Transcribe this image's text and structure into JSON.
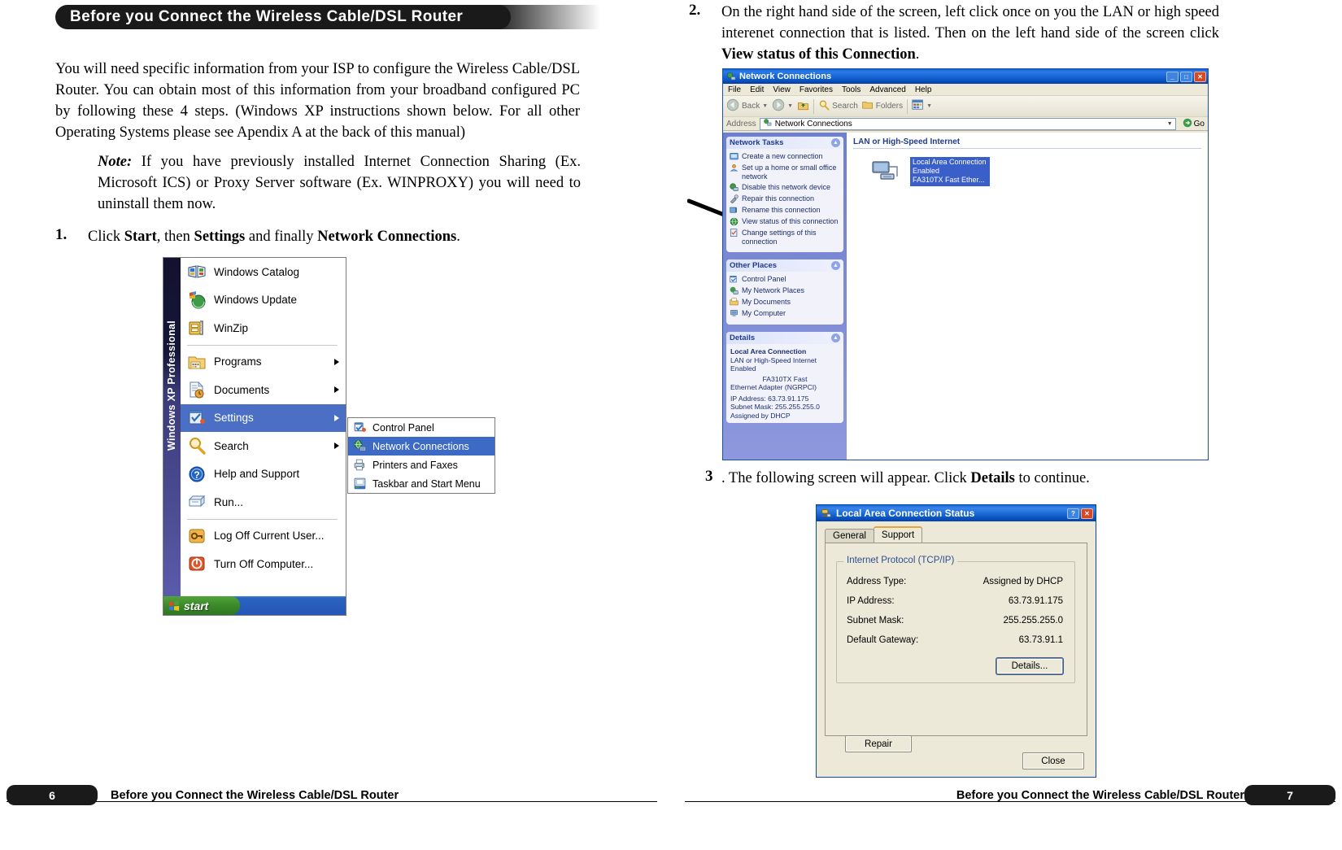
{
  "banner": {
    "title": "Before you Connect the Wireless Cable/DSL Router"
  },
  "intro": {
    "paragraph": "You will need specific information from your ISP to configure the Wireless Cable/DSL Router. You can obtain most of this information from your broadband configured PC by following these 4 steps. (Windows XP instructions shown below. For all other Operating Systems please see Apendix A at the back of this manual)",
    "note_label": "Note:",
    "note_text": "If you have previously installed Internet Connection Sharing (Ex. Microsoft ICS) or Proxy Server software (Ex. WINPROXY) you will need to uninstall them now."
  },
  "steps": {
    "one_num": "1.",
    "one_a": "Click ",
    "one_b1": "Start",
    "one_c": ", then ",
    "one_b2": "Settings",
    "one_d": " and finally ",
    "one_b3": "Network Connections",
    "one_e": ".",
    "two_num": "2.",
    "two_a": "On the right hand side of the screen, left click once on you the LAN or high speed interenet connection that is listed. Then on the left hand side of the screen click ",
    "two_b": "View status of this Connection",
    "two_c": ".",
    "three_num": "3",
    "three_a": ". The following screen will appear. Click ",
    "three_b": "Details",
    "three_c": " to continue."
  },
  "startmenu": {
    "sidebar_text": "Windows XP Professional",
    "items": [
      {
        "label": "Windows Catalog",
        "icon": "windows-catalog-icon",
        "arrow": false
      },
      {
        "label": "Windows Update",
        "icon": "windows-update-icon",
        "arrow": false
      },
      {
        "label": "WinZip",
        "icon": "winzip-icon",
        "arrow": false
      },
      {
        "label": "Programs",
        "icon": "programs-folder-icon",
        "arrow": true
      },
      {
        "label": "Documents",
        "icon": "documents-icon",
        "arrow": true
      },
      {
        "label": "Settings",
        "icon": "settings-icon",
        "arrow": true,
        "selected": true
      },
      {
        "label": "Search",
        "icon": "search-magnifier-icon",
        "arrow": true
      },
      {
        "label": "Help and Support",
        "icon": "help-question-icon",
        "arrow": false
      },
      {
        "label": "Run...",
        "icon": "run-icon",
        "arrow": false
      },
      {
        "label": "Log Off Current User...",
        "icon": "log-off-key-icon",
        "arrow": false
      },
      {
        "label": "Turn Off Computer...",
        "icon": "power-icon",
        "arrow": false
      }
    ],
    "submenu": [
      {
        "label": "Control Panel",
        "icon": "control-panel-icon",
        "selected": false
      },
      {
        "label": "Network Connections",
        "icon": "network-connections-icon",
        "selected": true
      },
      {
        "label": "Printers and Faxes",
        "icon": "printers-faxes-icon",
        "selected": false
      },
      {
        "label": "Taskbar and Start Menu",
        "icon": "taskbar-start-menu-icon",
        "selected": false
      }
    ],
    "start_button": "start"
  },
  "netconn": {
    "window_title": "Network Connections",
    "title_icon": "network-connections-icon",
    "win_buttons": [
      "minimize",
      "maximize",
      "close"
    ],
    "menus": [
      "File",
      "Edit",
      "View",
      "Favorites",
      "Tools",
      "Advanced",
      "Help"
    ],
    "toolbar": {
      "back": "Back",
      "search": "Search",
      "folders": "Folders",
      "views_icon": "views-icon"
    },
    "address": {
      "label": "Address",
      "value": "Network Connections",
      "go": "Go"
    },
    "network_tasks": {
      "header": "Network Tasks",
      "items": [
        "Create a new connection",
        "Set up a home or small office network",
        "Disable this network device",
        "Repair this connection",
        "Rename this connection",
        "View status of this connection",
        "Change settings of this connection"
      ]
    },
    "other_places": {
      "header": "Other Places",
      "items": [
        "Control Panel",
        "My Network Places",
        "My Documents",
        "My Computer"
      ]
    },
    "details": {
      "header": "Details",
      "name": "Local Area Connection",
      "type": "LAN or High-Speed Internet",
      "state": "Enabled",
      "adapter_line1": "FA310TX Fast",
      "adapter_line2": "Ethernet Adapter (NGRPCI)",
      "ip": "IP Address: 63.73.91.175",
      "mask": "Subnet Mask: 255.255.255.0",
      "dhcp": "Assigned by DHCP"
    },
    "group_header": "LAN or High-Speed Internet",
    "connection": {
      "name": "Local Area Connection",
      "status": "Enabled",
      "adapter": "FA310TX Fast Ether..."
    }
  },
  "lacstatus": {
    "window_title": "Local Area Connection Status",
    "title_icon": "network-status-icon",
    "help_button": "?",
    "close_button": "✕",
    "tabs": [
      {
        "label": "General",
        "active": false
      },
      {
        "label": "Support",
        "active": true
      }
    ],
    "fieldset_legend": "Internet Protocol (TCP/IP)",
    "rows": [
      {
        "label": "Address Type:",
        "value": "Assigned by DHCP"
      },
      {
        "label": "IP Address:",
        "value": "63.73.91.175"
      },
      {
        "label": "Subnet Mask:",
        "value": "255.255.255.0"
      },
      {
        "label": "Default Gateway:",
        "value": "63.73.91.1"
      }
    ],
    "details_button": "Details...",
    "repair_button": "Repair",
    "close_label": "Close"
  },
  "footer": {
    "left_page": "6",
    "left_text": "Before you Connect the Wireless Cable/DSL Router",
    "right_text": "Before you Connect the Wireless Cable/DSL Router",
    "right_page": "7"
  }
}
